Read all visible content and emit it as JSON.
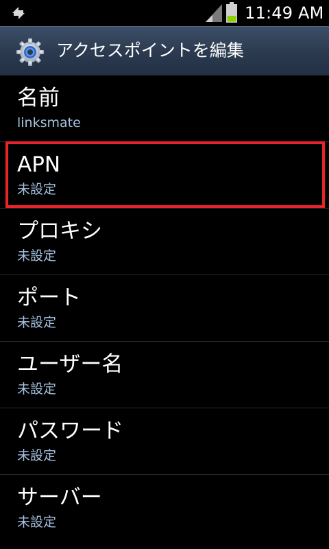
{
  "status_bar": {
    "time": "11:49 AM",
    "icons": [
      "sync-icon",
      "signal-icon",
      "battery-icon"
    ]
  },
  "title_bar": {
    "icon": "gear-icon",
    "title": "アクセスポイントを編集"
  },
  "settings": [
    {
      "label": "名前",
      "value": "linksmate"
    },
    {
      "label": "APN",
      "value": "未設定"
    },
    {
      "label": "プロキシ",
      "value": "未設定"
    },
    {
      "label": "ポート",
      "value": "未設定"
    },
    {
      "label": "ユーザー名",
      "value": "未設定"
    },
    {
      "label": "パスワード",
      "value": "未設定"
    },
    {
      "label": "サーバー",
      "value": "未設定"
    }
  ],
  "colors": {
    "background": "#000000",
    "title_bar": "#2c3b50",
    "value_text": "#a6c2e0",
    "highlight_border": "#e8232a",
    "battery_green": "#8cd100"
  },
  "highlighted_item": "APN"
}
